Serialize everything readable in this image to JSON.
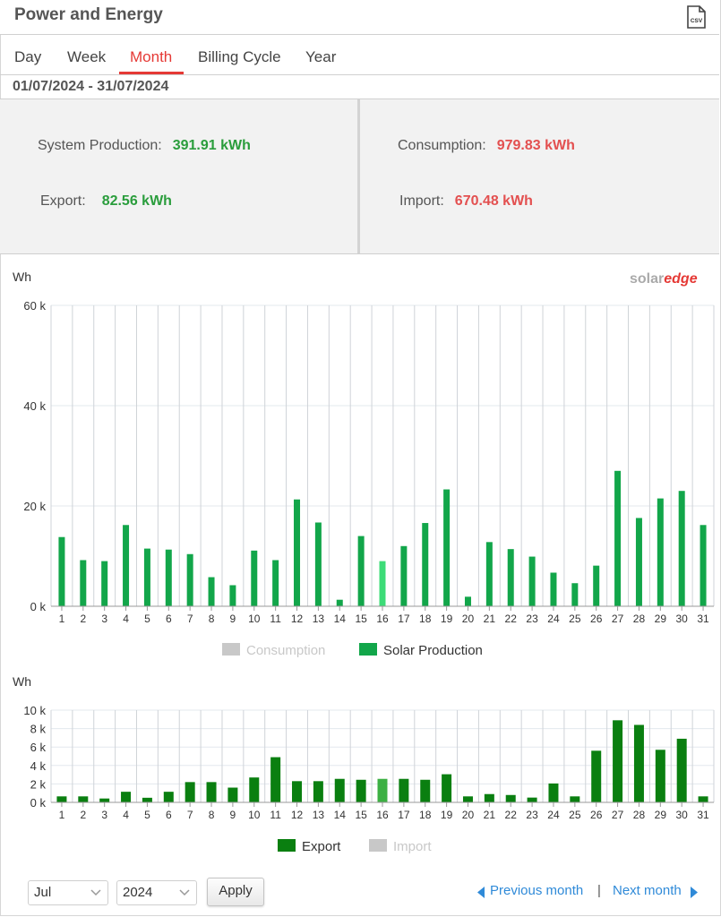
{
  "header": {
    "title": "Power and Energy",
    "export_icon": "csv-file-icon",
    "export_label": "CSV"
  },
  "tabs": [
    {
      "label": "Day",
      "active": false
    },
    {
      "label": "Week",
      "active": false
    },
    {
      "label": "Month",
      "active": true
    },
    {
      "label": "Billing Cycle",
      "active": false
    },
    {
      "label": "Year",
      "active": false
    }
  ],
  "date_range": "01/07/2024 - 31/07/2024",
  "summary": {
    "system_production": {
      "label": "System Production:",
      "value": "391.91 kWh"
    },
    "export": {
      "label": "Export:",
      "value": "82.56 kWh"
    },
    "consumption": {
      "label": "Consumption:",
      "value": "979.83 kWh"
    },
    "import": {
      "label": "Import:",
      "value": "670.48 kWh"
    }
  },
  "brand": {
    "logo_text": "solaredge",
    "logo_part1": "solar",
    "logo_part2": "edge"
  },
  "colors": {
    "accent_red": "#e53935",
    "production_green": "#12a64a",
    "production_highlight": "#3ddc78",
    "export_green": "#0a7f10",
    "export_highlight": "#3cb043",
    "legend_inactive": "#c8c8c8",
    "value_green": "#2a9d3c",
    "value_red": "#e35050",
    "link_blue": "#2f8ad8"
  },
  "chart_data": [
    {
      "type": "bar",
      "ylabel": "Wh",
      "ylim": [
        0,
        60000
      ],
      "y_ticks": [
        "0 k",
        "20 k",
        "40 k",
        "60 k"
      ],
      "categories": [
        "1",
        "2",
        "3",
        "4",
        "5",
        "6",
        "7",
        "8",
        "9",
        "10",
        "11",
        "12",
        "13",
        "14",
        "15",
        "16",
        "17",
        "18",
        "19",
        "20",
        "21",
        "22",
        "23",
        "24",
        "25",
        "26",
        "27",
        "28",
        "29",
        "30",
        "31"
      ],
      "legend": [
        {
          "label": "Consumption",
          "active": false
        },
        {
          "label": "Solar Production",
          "active": true
        }
      ],
      "series": [
        {
          "name": "Solar Production",
          "values": [
            13800,
            9200,
            9000,
            16200,
            11500,
            11300,
            10400,
            5800,
            4200,
            11100,
            9200,
            21300,
            16700,
            1300,
            14000,
            9000,
            12000,
            16600,
            23300,
            1900,
            12800,
            11400,
            9900,
            6700,
            4600,
            8100,
            27000,
            17600,
            21500,
            23000,
            16200
          ]
        }
      ],
      "highlight_index": 15
    },
    {
      "type": "bar",
      "ylabel": "Wh",
      "ylim": [
        0,
        10000
      ],
      "y_ticks": [
        "0 k",
        "2 k",
        "4 k",
        "6 k",
        "8 k",
        "10 k"
      ],
      "categories": [
        "1",
        "2",
        "3",
        "4",
        "5",
        "6",
        "7",
        "8",
        "9",
        "10",
        "11",
        "12",
        "13",
        "14",
        "15",
        "16",
        "17",
        "18",
        "19",
        "20",
        "21",
        "22",
        "23",
        "24",
        "25",
        "26",
        "27",
        "28",
        "29",
        "30",
        "31"
      ],
      "legend": [
        {
          "label": "Export",
          "active": true
        },
        {
          "label": "Import",
          "active": false
        }
      ],
      "series": [
        {
          "name": "Export",
          "values": [
            650,
            650,
            420,
            1150,
            500,
            1150,
            2200,
            2200,
            1600,
            2700,
            4900,
            2300,
            2300,
            2550,
            2450,
            2550,
            2550,
            2450,
            3050,
            650,
            900,
            800,
            520,
            2050,
            650,
            5600,
            8900,
            8400,
            5700,
            6900,
            650
          ]
        }
      ],
      "highlight_index": 15
    }
  ],
  "controls": {
    "month_select": "Jul",
    "year_select": "2024",
    "apply_label": "Apply",
    "prev_label": "Previous month",
    "next_label": "Next month",
    "separator": "|"
  }
}
